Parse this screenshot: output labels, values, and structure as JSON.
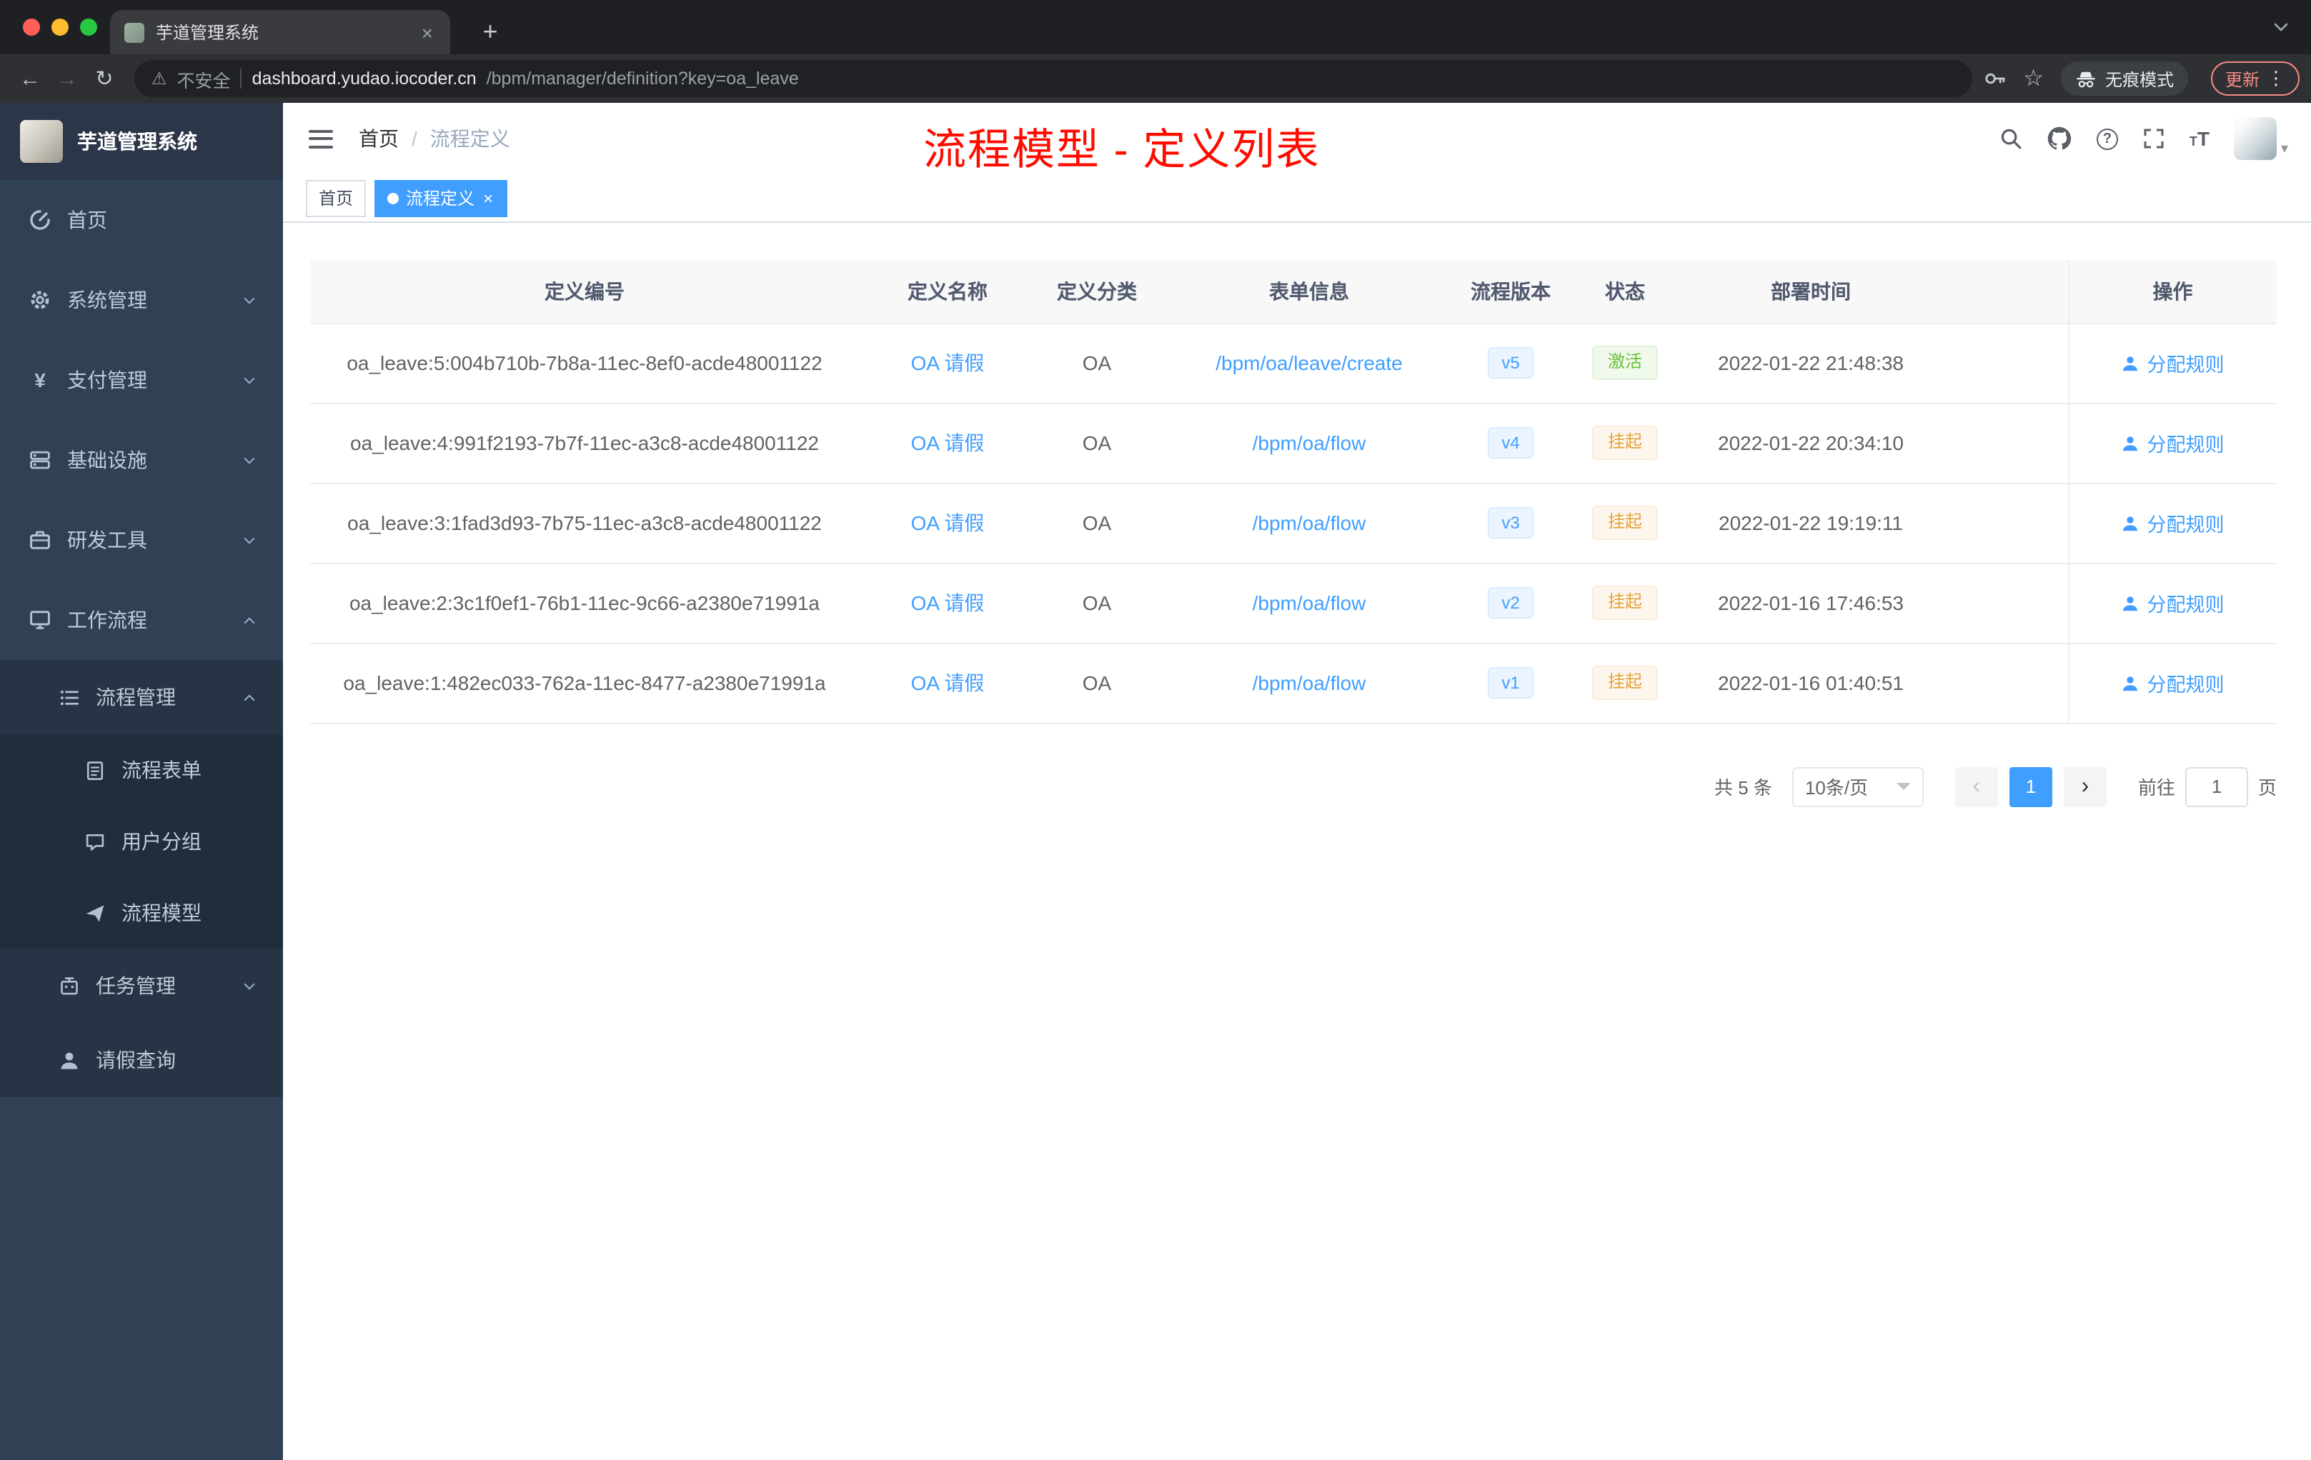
{
  "colors": {
    "accent": "#409eff",
    "success": "#67c23a",
    "warning": "#e6a23c",
    "annotation": "#ff0c00",
    "sidebar_bg": "#304156"
  },
  "icons": {
    "close": "×",
    "plus": "+",
    "dots": "⋮",
    "warning": "⚠",
    "back": "←",
    "forward": "→",
    "reload": "↻",
    "star": "☆",
    "prev": "‹",
    "next": "›",
    "yen": "¥",
    "question": "?",
    "fontsize_small": "T",
    "fontsize_big": "T",
    "avatar_caret": "▾"
  },
  "browser": {
    "tab_title": "芋道管理系统",
    "security_label": "不安全",
    "url_host": "dashboard.yudao.iocoder.cn",
    "url_path": "/bpm/manager/definition?key=oa_leave",
    "incognito_label": "无痕模式",
    "update_label": "更新"
  },
  "sidebar": {
    "logo_title": "芋道管理系统",
    "items": [
      {
        "label": "首页"
      },
      {
        "label": "系统管理"
      },
      {
        "label": "支付管理"
      },
      {
        "label": "基础设施"
      },
      {
        "label": "研发工具"
      },
      {
        "label": "工作流程"
      },
      {
        "label": "流程管理"
      },
      {
        "label": "流程表单"
      },
      {
        "label": "用户分组"
      },
      {
        "label": "流程模型"
      },
      {
        "label": "任务管理"
      },
      {
        "label": "请假查询"
      }
    ]
  },
  "header": {
    "breadcrumb_home": "首页",
    "breadcrumb_sep": "/",
    "breadcrumb_current": "流程定义",
    "annotation": "流程模型 - 定义列表"
  },
  "tags": {
    "home": "首页",
    "active": "流程定义"
  },
  "table": {
    "headers": {
      "id": "定义编号",
      "name": "定义名称",
      "category": "定义分类",
      "form": "表单信息",
      "version": "流程版本",
      "status": "状态",
      "deploy_time": "部署时间",
      "ops": "操作"
    },
    "rows": [
      {
        "id": "oa_leave:5:004b710b-7b8a-11ec-8ef0-acde48001122",
        "name": "OA 请假",
        "category": "OA",
        "form": "/bpm/oa/leave/create",
        "version": "v5",
        "status": "激活",
        "deploy_time": "2022-01-22 21:48:38",
        "action": "分配规则"
      },
      {
        "id": "oa_leave:4:991f2193-7b7f-11ec-a3c8-acde48001122",
        "name": "OA 请假",
        "category": "OA",
        "form": "/bpm/oa/flow",
        "version": "v4",
        "status": "挂起",
        "deploy_time": "2022-01-22 20:34:10",
        "action": "分配规则"
      },
      {
        "id": "oa_leave:3:1fad3d93-7b75-11ec-a3c8-acde48001122",
        "name": "OA 请假",
        "category": "OA",
        "form": "/bpm/oa/flow",
        "version": "v3",
        "status": "挂起",
        "deploy_time": "2022-01-22 19:19:11",
        "action": "分配规则"
      },
      {
        "id": "oa_leave:2:3c1f0ef1-76b1-11ec-9c66-a2380e71991a",
        "name": "OA 请假",
        "category": "OA",
        "form": "/bpm/oa/flow",
        "version": "v2",
        "status": "挂起",
        "deploy_time": "2022-01-16 17:46:53",
        "action": "分配规则"
      },
      {
        "id": "oa_leave:1:482ec033-762a-11ec-8477-a2380e71991a",
        "name": "OA 请假",
        "category": "OA",
        "form": "/bpm/oa/flow",
        "version": "v1",
        "status": "挂起",
        "deploy_time": "2022-01-16 01:40:51",
        "action": "分配规则"
      }
    ]
  },
  "pagination": {
    "total": "共 5 条",
    "page_size": "10条/页",
    "page": "1",
    "goto": "前往",
    "goto_value": "1",
    "unit": "页"
  }
}
